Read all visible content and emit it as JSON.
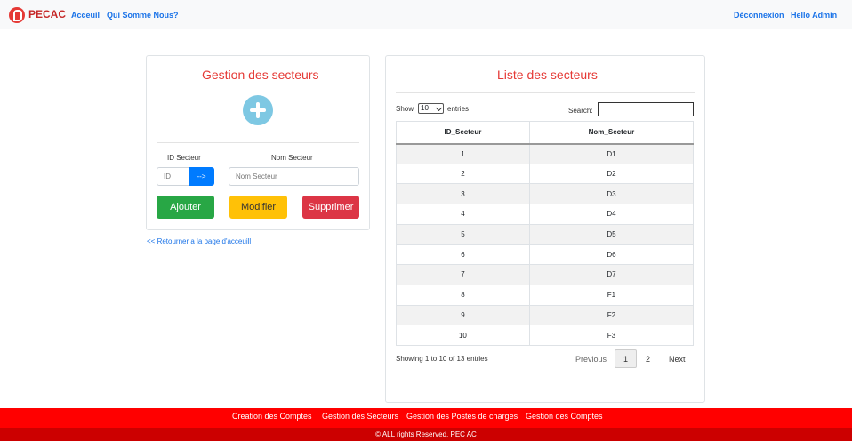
{
  "navbar": {
    "brand": "PECAC",
    "links": [
      "Acceuil",
      "Qui Somme Nous?"
    ],
    "logout": "Déconnexion",
    "greeting": "Hello Admin"
  },
  "form_card": {
    "title": "Gestion des secteurs",
    "add_icon": "plus-circle-icon",
    "id_label": "ID Secteur",
    "id_placeholder": "ID",
    "arrow_button": "-->",
    "name_label": "Nom Secteur",
    "name_placeholder": "Nom Secteur",
    "buttons": {
      "add": "Ajouter",
      "edit": "Modifier",
      "delete": "Supprimer"
    },
    "colors": {
      "add": "#28a745",
      "edit": "#ffc107",
      "delete": "#dc3545",
      "arrow": "#007bff"
    }
  },
  "back_link": "<< Retourner a la page d'acceuill",
  "list_card": {
    "title": "Liste des secteurs",
    "show_label": "Show",
    "entries_value": "10",
    "entries_label": "entries",
    "search_label": "Search:",
    "columns": [
      "ID_Secteur",
      "Nom_Secteur"
    ],
    "rows": [
      [
        "1",
        "D1"
      ],
      [
        "2",
        "D2"
      ],
      [
        "3",
        "D3"
      ],
      [
        "4",
        "D4"
      ],
      [
        "5",
        "D5"
      ],
      [
        "6",
        "D6"
      ],
      [
        "7",
        "D7"
      ],
      [
        "8",
        "F1"
      ],
      [
        "9",
        "F2"
      ],
      [
        "10",
        "F3"
      ]
    ],
    "info": "Showing 1 to 10 of 13 entries",
    "pagination": {
      "previous": "Previous",
      "pages": [
        "1",
        "2"
      ],
      "current": "1",
      "next": "Next"
    }
  },
  "footer": {
    "links": [
      "Creation des Comptes",
      "Gestion des Secteurs",
      "Gestion des Postes de charges",
      "Gestion des Comptes"
    ],
    "copyright": "© ALL rights Reserved. PEC AC"
  }
}
